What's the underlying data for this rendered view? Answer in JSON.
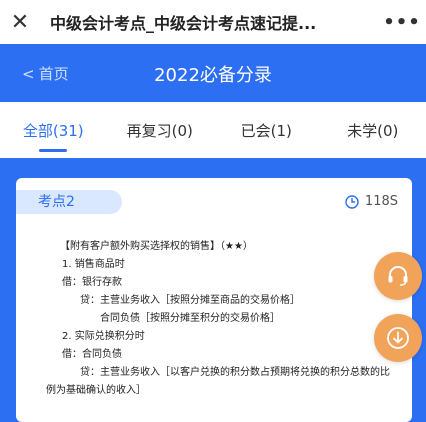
{
  "window": {
    "title": "中级会计考点_中级会计考点速记提...",
    "close_icon": "close-icon",
    "more_label": "•••"
  },
  "header": {
    "back_label": "首页",
    "title": "2022必备分录"
  },
  "tabs": [
    {
      "label": "全部(31)",
      "active": true
    },
    {
      "label": "再复习(0)",
      "active": false
    },
    {
      "label": "已会(1)",
      "active": false
    },
    {
      "label": "未学(0)",
      "active": false
    }
  ],
  "card": {
    "badge": "考点2",
    "timer": "118S",
    "lines": [
      "【附有客户额外购买选择权的销售】（★★）",
      "1. 销售商品时",
      "借：银行存款",
      "贷：主营业务收入［按照分摊至商品的交易价格］",
      "合同负债［按照分摊至积分的交易价格］",
      "2. 实际兑换积分时",
      "借：合同负债",
      "贷：主营业务收入［以客户兑换的积分数占预期将兑换的积分总数的比",
      "例为基础确认的收入］"
    ]
  },
  "colors": {
    "primary": "#2c6ff2",
    "fab": "#f2a35a"
  }
}
